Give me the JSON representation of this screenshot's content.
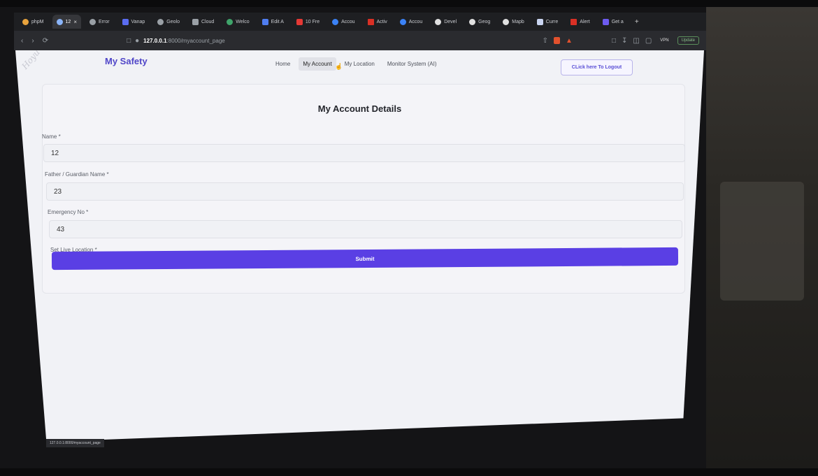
{
  "browser": {
    "tabs": [
      {
        "label": "phpM",
        "active": false
      },
      {
        "label": "12",
        "active": true
      },
      {
        "label": "Error",
        "active": false
      },
      {
        "label": "Vanap",
        "active": false
      },
      {
        "label": "Geolo",
        "active": false
      },
      {
        "label": "Cloud",
        "active": false
      },
      {
        "label": "Welco",
        "active": false
      },
      {
        "label": "Edit A",
        "active": false
      },
      {
        "label": "10 Fre",
        "active": false
      },
      {
        "label": "Accou",
        "active": false
      },
      {
        "label": "Activ",
        "active": false
      },
      {
        "label": "Accou",
        "active": false
      },
      {
        "label": "Devel",
        "active": false
      },
      {
        "label": "Geog",
        "active": false
      },
      {
        "label": "Mapb",
        "active": false
      },
      {
        "label": "Curre",
        "active": false
      },
      {
        "label": "Alert",
        "active": false
      },
      {
        "label": "Get a",
        "active": false
      }
    ],
    "close_glyph": "×",
    "new_tab_glyph": "+",
    "url_host": "127.0.0.1",
    "url_path": ":8000/myaccount_page",
    "vpn_label": "VPN",
    "update_label": "Update",
    "status_url": "127.0.0.1:8000/myaccount_page"
  },
  "site": {
    "brand": "My Safety",
    "watermark": "Hoyu",
    "nav": [
      {
        "label": "Home",
        "active": false
      },
      {
        "label": "My Account",
        "active": true
      },
      {
        "label": "My Location",
        "active": false
      },
      {
        "label": "Monitor System (AI)",
        "active": false
      }
    ],
    "logout_label": "CLick here To Logout"
  },
  "form": {
    "title": "My Account Details",
    "fields": [
      {
        "label": "Name *",
        "value": "12"
      },
      {
        "label": "Father / Guardian Name *",
        "value": "23"
      },
      {
        "label": "Emergency No *",
        "value": "43"
      },
      {
        "label": "Set Live Location *",
        "value": ""
      }
    ],
    "submit_label": "Submit"
  },
  "colors": {
    "brand": "#5046c8",
    "submit": "#5a3fe4"
  }
}
